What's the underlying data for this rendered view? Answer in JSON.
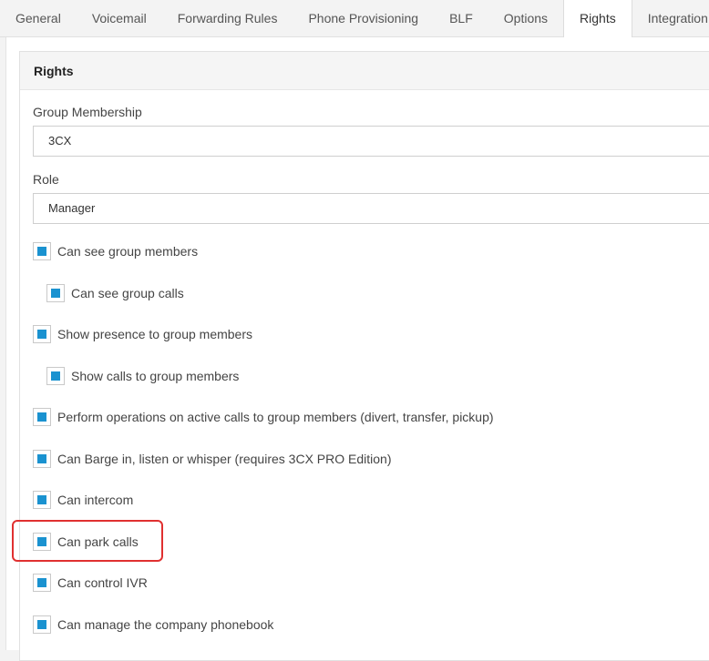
{
  "tabs": [
    {
      "label": "General",
      "active": false
    },
    {
      "label": "Voicemail",
      "active": false
    },
    {
      "label": "Forwarding Rules",
      "active": false
    },
    {
      "label": "Phone Provisioning",
      "active": false
    },
    {
      "label": "BLF",
      "active": false
    },
    {
      "label": "Options",
      "active": false
    },
    {
      "label": "Rights",
      "active": true
    },
    {
      "label": "Integration",
      "active": false
    }
  ],
  "panel": {
    "title": "Rights",
    "group_membership": {
      "label": "Group Membership",
      "value": "3CX"
    },
    "role": {
      "label": "Role",
      "value": "Manager"
    },
    "checkboxes": [
      {
        "label": "Can see group members",
        "checked": true,
        "indent": false
      },
      {
        "label": "Can see group calls",
        "checked": true,
        "indent": true
      },
      {
        "label": "Show presence to group members",
        "checked": true,
        "indent": false
      },
      {
        "label": "Show calls to group members",
        "checked": true,
        "indent": true
      },
      {
        "label": "Perform operations on active calls to group members (divert, transfer, pickup)",
        "checked": true,
        "indent": false
      },
      {
        "label": "Can Barge in, listen or whisper (requires 3CX PRO Edition)",
        "checked": true,
        "indent": false
      },
      {
        "label": "Can intercom",
        "checked": true,
        "indent": false
      },
      {
        "label": "Can park calls",
        "checked": true,
        "indent": false,
        "highlighted": true
      },
      {
        "label": "Can control IVR",
        "checked": true,
        "indent": false
      },
      {
        "label": "Can manage the company phonebook",
        "checked": true,
        "indent": false
      }
    ]
  },
  "colors": {
    "accent": "#1a92d0",
    "highlight": "#e03030"
  }
}
